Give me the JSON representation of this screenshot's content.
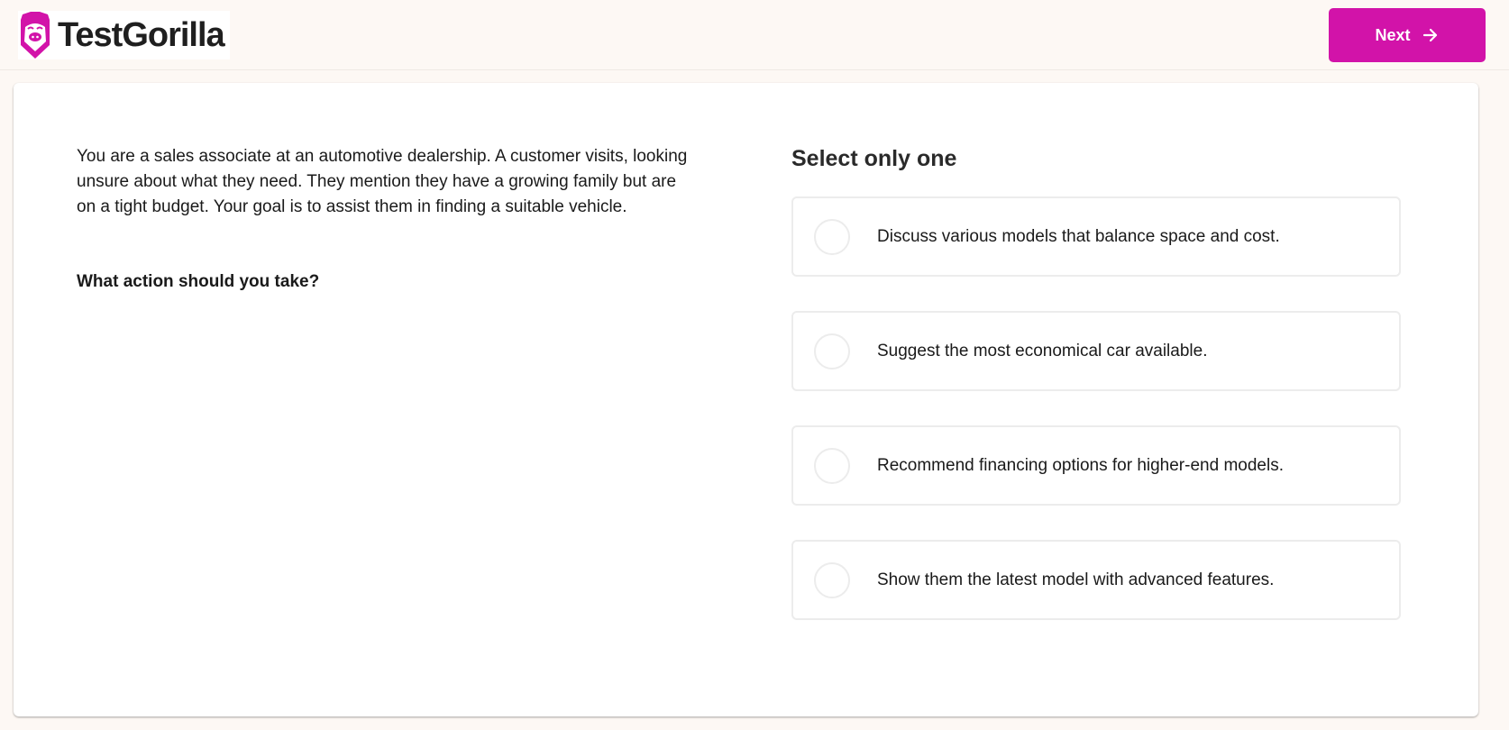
{
  "header": {
    "brand_name": "TestGorilla",
    "logo_icon": "gorilla-logo-icon",
    "next_button": {
      "label": "Next",
      "icon": "arrow-right-icon"
    }
  },
  "colors": {
    "accent": "#d213a9",
    "background": "#fdf8f4",
    "card": "#ffffff",
    "option_border": "#ececec"
  },
  "question": {
    "scenario": "You are a sales associate at an automotive dealership. A customer visits, looking unsure about what they need. They mention they have a growing family but are on a tight budget. Your goal is to assist them in finding a suitable vehicle.",
    "prompt": "What action should you take?"
  },
  "answers": {
    "instruction": "Select only one",
    "options": [
      {
        "label": "Discuss various models that balance space and cost.",
        "selected": false
      },
      {
        "label": "Suggest the most economical car available.",
        "selected": false
      },
      {
        "label": "Recommend financing options for higher-end models.",
        "selected": false
      },
      {
        "label": "Show them the latest model with advanced features.",
        "selected": false
      }
    ]
  }
}
